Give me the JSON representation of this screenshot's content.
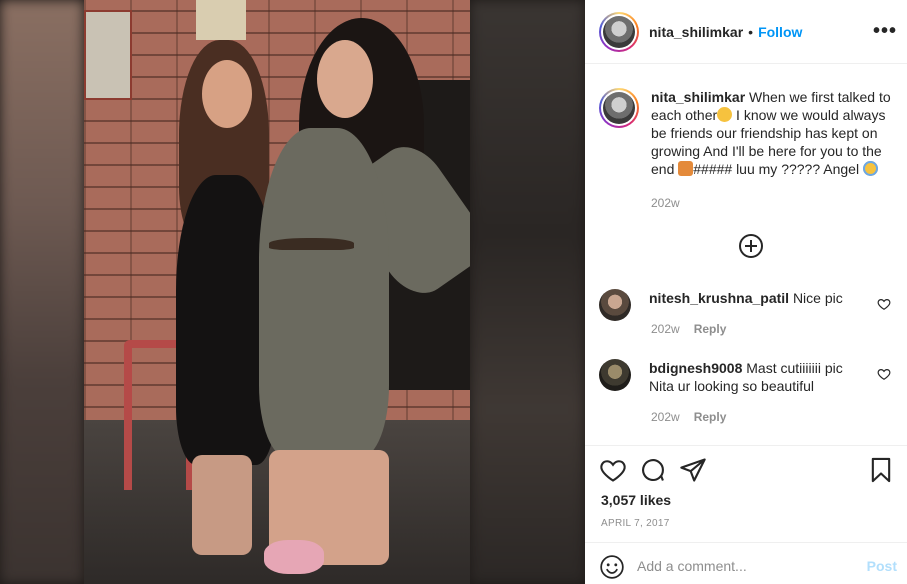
{
  "post": {
    "username": "nita_shilimkar",
    "follow_label": "Follow",
    "more_label": "•••",
    "caption_pre": "When we first talked to each other",
    "caption_mid": " I know we would always be friends our friendship has kept on growing And I'll be here for you to the end ",
    "caption_mid2": "##### luu my ????? Angel ",
    "caption_time": "202w",
    "likes": "3,057 likes",
    "date": "APRIL 7, 2017"
  },
  "comments": [
    {
      "username": "nitesh_krushna_patil",
      "text": "Nice pic",
      "time": "202w",
      "reply_label": "Reply"
    },
    {
      "username": "bdignesh9008",
      "text": "Mast cutiiiiiii pic Nita ur looking so beautiful",
      "time": "202w",
      "reply_label": "Reply"
    }
  ],
  "add_comment": {
    "placeholder": "Add a comment...",
    "post_label": "Post"
  },
  "icons": {
    "more": "more-options-icon",
    "load_more": "plus-circle-icon",
    "like": "heart-icon",
    "comment": "comment-bubble-icon",
    "share": "paper-plane-icon",
    "save": "bookmark-icon",
    "emoji": "smiley-icon"
  },
  "colors": {
    "accent": "#0095f6",
    "post_disabled": "#b2dffc",
    "muted": "#8e8e8e",
    "text": "#262626"
  }
}
